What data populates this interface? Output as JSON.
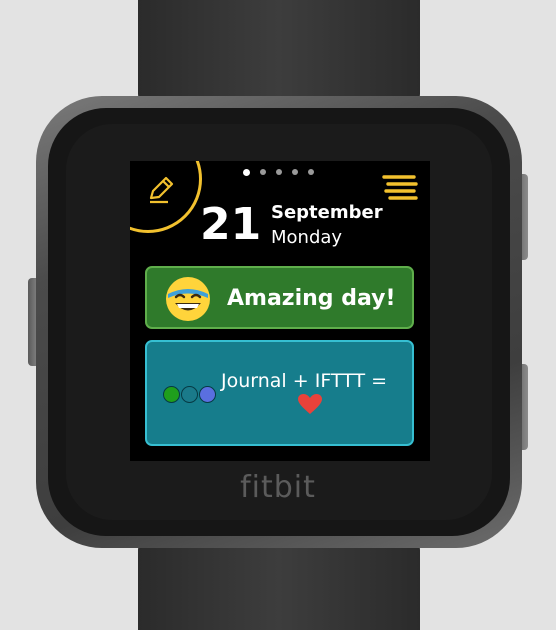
{
  "device": {
    "brand": "fitbit"
  },
  "screen": {
    "page_indicator": {
      "count": 5,
      "active_index": 0
    },
    "toolbar": {
      "edit_icon": "pencil-icon",
      "menu_icon": "list-menu-icon",
      "accent_color": "#f2c12e"
    },
    "date": {
      "day": "21",
      "month": "September",
      "weekday": "Monday"
    },
    "mood_card": {
      "label": "Amazing day!",
      "icon": "grinning-face-emoji",
      "bg_color": "#2f7a2b",
      "border_color": "#5fae4b"
    },
    "ifttt_card": {
      "text": "Journal + IFTTT =",
      "icon": "heart-icon",
      "dot_colors": [
        "#1f9e1c",
        "#1a7a8a",
        "#5a6fe0"
      ],
      "bg_color": "#167d8c",
      "border_color": "#36bfd2"
    }
  }
}
